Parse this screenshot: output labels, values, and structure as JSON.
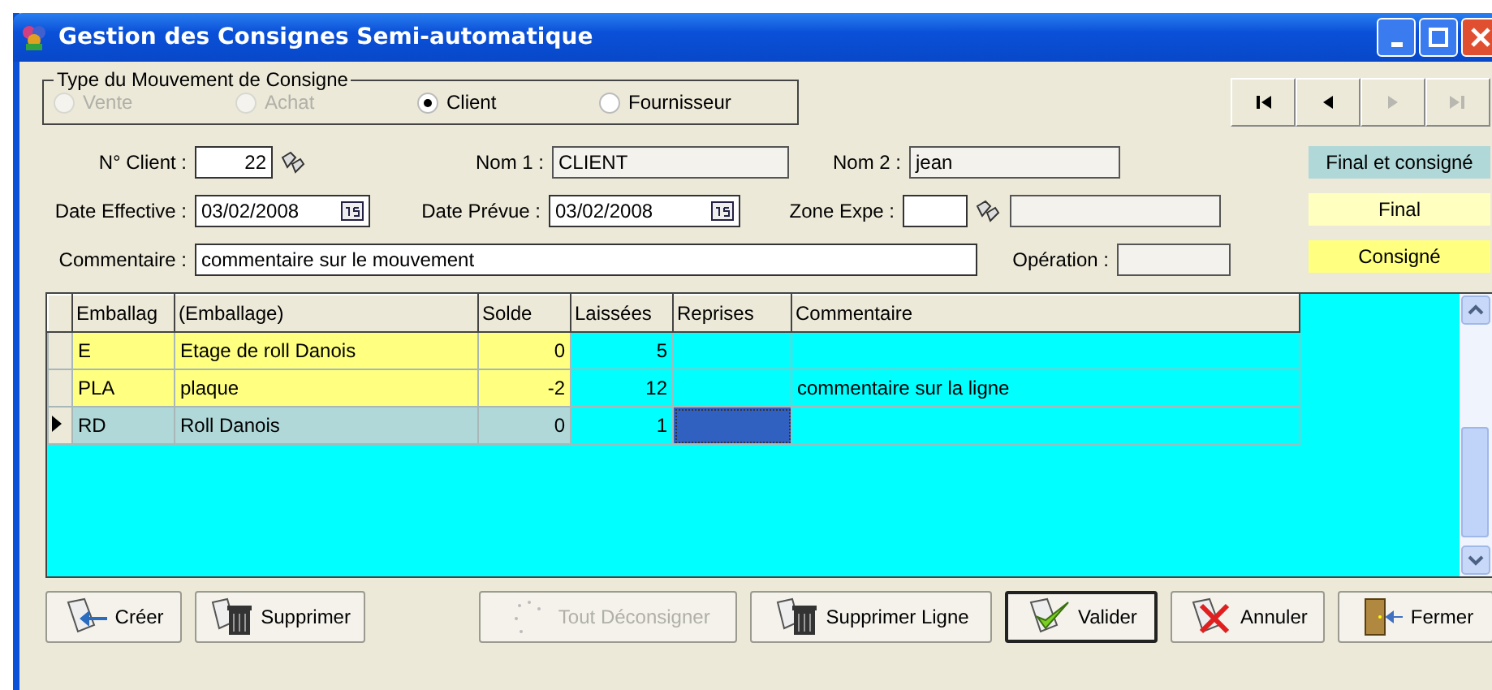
{
  "window": {
    "title": "Gestion des Consignes Semi-automatique"
  },
  "movement_type": {
    "legend": "Type du Mouvement de Consigne",
    "options": [
      {
        "label": "Vente",
        "selected": false,
        "disabled": true
      },
      {
        "label": "Achat",
        "selected": false,
        "disabled": true
      },
      {
        "label": "Client",
        "selected": true,
        "disabled": false
      },
      {
        "label": "Fournisseur",
        "selected": false,
        "disabled": false
      }
    ]
  },
  "navigation": [
    {
      "kind": "first",
      "disabled": false
    },
    {
      "kind": "prev",
      "disabled": false
    },
    {
      "kind": "next",
      "disabled": true
    },
    {
      "kind": "last",
      "disabled": true
    }
  ],
  "legend": [
    {
      "label": "Final et consigné",
      "kind": "final_consigne"
    },
    {
      "label": "Final",
      "kind": "final"
    },
    {
      "label": "Consigné",
      "kind": "consigne"
    }
  ],
  "form": {
    "client_label": "N° Client :",
    "client": "22",
    "nom1_label": "Nom 1 :",
    "nom1": "CLIENT",
    "nom2_label": "Nom 2 :",
    "nom2": "jean",
    "date_eff_label": "Date Effective :",
    "date_eff": "03/02/2008",
    "date_prev_label": "Date Prévue :",
    "date_prev": "03/02/2008",
    "zone_label": "Zone Expe :",
    "comment_label": "Commentaire :",
    "comment": "commentaire sur le mouvement",
    "operation_label": "Opération :"
  },
  "table": {
    "columns": [
      "Emballag",
      "(Emballage)",
      "Solde",
      "Laissées",
      "Reprises",
      "Commentaire"
    ],
    "rows": [
      {
        "code": "E",
        "name": "Etage de roll Danois",
        "solde": "0",
        "laissees": "5",
        "reprises": "",
        "comment": "",
        "kind": "consigne",
        "selected": false
      },
      {
        "code": "PLA",
        "name": "plaque",
        "solde": "-2",
        "laissees": "12",
        "reprises": "",
        "comment": "commentaire sur la ligne",
        "kind": "consigne",
        "selected": false
      },
      {
        "code": "RD",
        "name": "Roll Danois",
        "solde": "0",
        "laissees": "1",
        "reprises": "",
        "comment": "",
        "kind": "final_consigne",
        "selected": true
      }
    ]
  },
  "buttons": [
    {
      "label": "Créer",
      "kind": "create",
      "disabled": false,
      "default": false
    },
    {
      "label": "Supprimer",
      "kind": "delete",
      "disabled": false,
      "default": false
    },
    {
      "label": "Tout Déconsigner",
      "kind": "release",
      "disabled": true,
      "default": false
    },
    {
      "label": "Supprimer Ligne",
      "kind": "delete",
      "disabled": false,
      "default": false
    },
    {
      "label": "Valider",
      "kind": "validate",
      "disabled": false,
      "default": true
    },
    {
      "label": "Annuler",
      "kind": "cancel",
      "disabled": false,
      "default": false
    },
    {
      "label": "Fermer",
      "kind": "close",
      "disabled": false,
      "default": false
    }
  ]
}
